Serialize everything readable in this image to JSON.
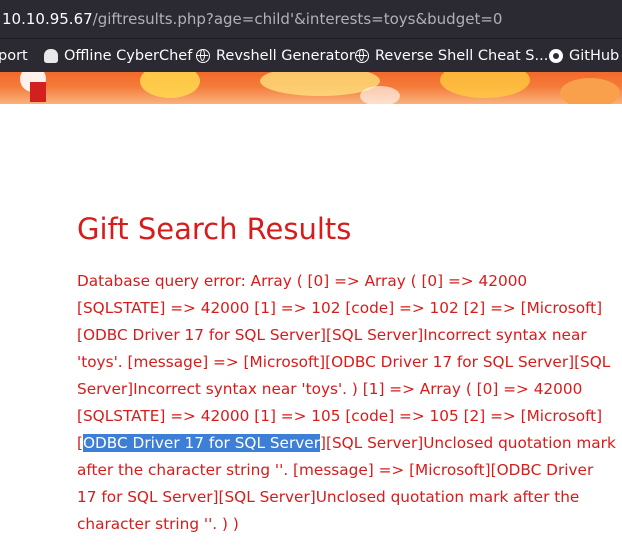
{
  "url": {
    "host": "10.10.95.67",
    "path": "/giftresults.php?age=child'&interests=toys&budget=0"
  },
  "bookmarks": [
    {
      "label": "port",
      "icon": "none"
    },
    {
      "label": "Offline CyberChef",
      "icon": "chef-hat-icon"
    },
    {
      "label": "Revshell Generator",
      "icon": "globe-icon"
    },
    {
      "label": "Reverse Shell Cheat S...",
      "icon": "globe-icon"
    },
    {
      "label": "GitHub -",
      "icon": "github-icon"
    }
  ],
  "page": {
    "title": "Gift Search Results",
    "error_before": "Database query error: Array ( [0] => Array ( [0] => 42000 [SQLSTATE] => 42000 [1] => 102 [code] => 102 [2] => [Microsoft][ODBC Driver 17 for SQL Server][SQL Server]Incorrect syntax near 'toys'. [message] => [Microsoft][ODBC Driver 17 for SQL Server][SQL Server]Incorrect syntax near 'toys'. ) [1] => Array ( [0] => 42000 [SQLSTATE] => 42000 [1] => 105 [code] => 105 [2] => [Microsoft][",
    "error_selected": "ODBC Driver 17 for SQL Server",
    "error_after": "][SQL Server]Unclosed quotation mark after the character string ''. [message] => [Microsoft][ODBC Driver 17 for SQL Server][SQL Server]Unclosed quotation mark after the character string ''. ) )"
  },
  "colors": {
    "error_red": "#d81b1b",
    "selection": "#3d7ed6",
    "browser_chrome": "#2b2a33"
  }
}
